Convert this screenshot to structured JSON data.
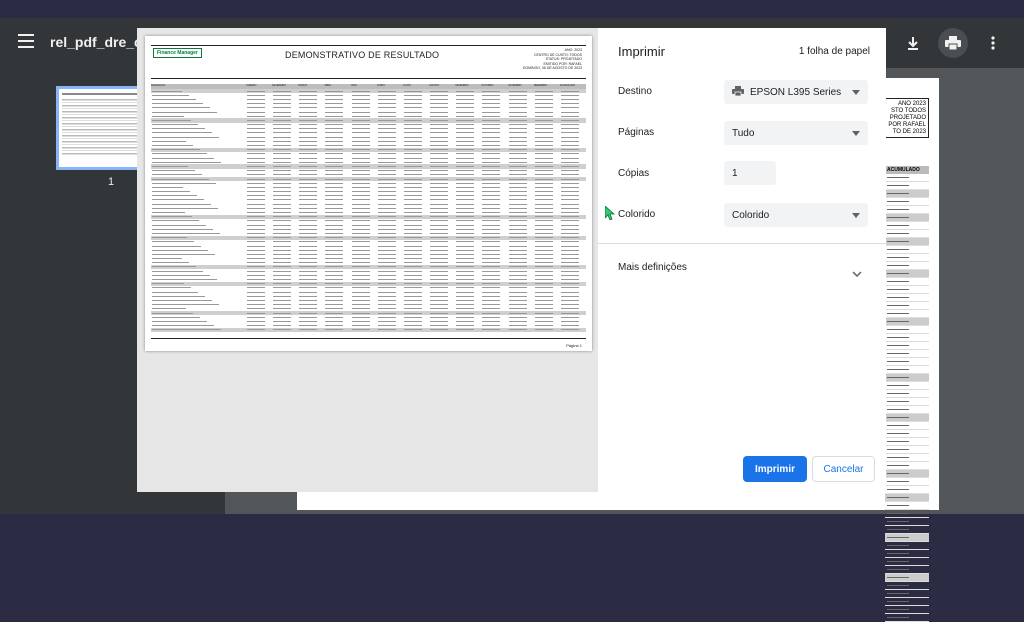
{
  "viewer": {
    "doc_title": "rel_pdf_dre_class.p",
    "page_number": "1",
    "bg_header_lines": [
      "ANO 2023",
      "STO TODOS",
      "PROJETADO",
      "POR RAFAEL",
      "TO DE 2023"
    ],
    "bg_column_header": "ACUMULADO"
  },
  "preview": {
    "logo": "Finance Manager",
    "title": "DEMONSTRATIVO DE RESULTADO",
    "info_lines": [
      "ANO: 2023",
      "CENTRO DE CUSTO: TODOS",
      "STATUS: PROJETADO",
      "EMITIDO POR: RAFAEL",
      "DOMINGO, 06 DE AGOSTO DE 2023"
    ],
    "columns": [
      "DESCRIÇÃO",
      "JANEIRO",
      "FEVEREIRO",
      "MARÇO",
      "ABRIL",
      "MAIO",
      "JUNHO",
      "JULHO",
      "AGOSTO",
      "SETEMBRO",
      "OUTUBRO",
      "NOVEMBRO",
      "DEZEMBRO",
      "ACUMULADO"
    ],
    "footer": "Página 1"
  },
  "print": {
    "title": "Imprimir",
    "sheet_count": "1 folha de papel",
    "destination_label": "Destino",
    "destination_value": "EPSON L395 Series",
    "pages_label": "Páginas",
    "pages_value": "Tudo",
    "copies_label": "Cópias",
    "copies_value": "1",
    "color_label": "Colorido",
    "color_value": "Colorido",
    "more_settings": "Mais definições",
    "print_button": "Imprimir",
    "cancel_button": "Cancelar"
  },
  "colors": {
    "accent": "#1a73e8",
    "toolbar": "#323639",
    "outer_bg": "#2b2c44"
  }
}
